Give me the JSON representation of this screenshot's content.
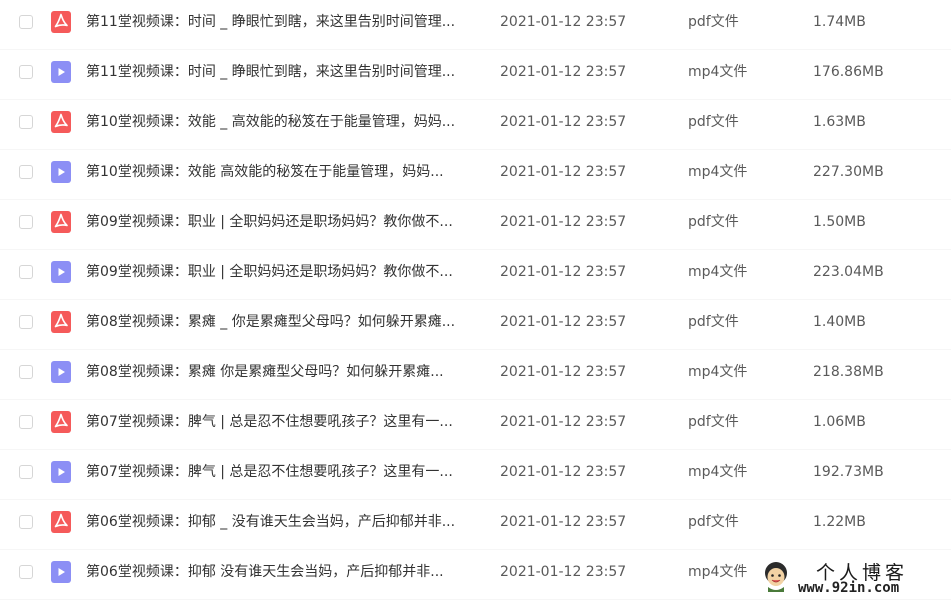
{
  "colors": {
    "pdf_icon": "#f55a5a",
    "mp4_icon": "#8c8ff5",
    "text_primary": "#333333",
    "text_secondary": "#5a5a5a"
  },
  "files": [
    {
      "name": "第11堂视频课：时间 _ 睁眼忙到瞎，来这里告别时间管理...",
      "date": "2021-01-12 23:57",
      "type": "pdf文件",
      "size": "1.74MB",
      "icon": "pdf-icon"
    },
    {
      "name": "第11堂视频课：时间 _ 睁眼忙到瞎，来这里告别时间管理...",
      "date": "2021-01-12 23:57",
      "type": "mp4文件",
      "size": "176.86MB",
      "icon": "video-icon"
    },
    {
      "name": "第10堂视频课：效能 _ 高效能的秘笈在于能量管理，妈妈...",
      "date": "2021-01-12 23:57",
      "type": "pdf文件",
      "size": "1.63MB",
      "icon": "pdf-icon"
    },
    {
      "name": "第10堂视频课：效能  高效能的秘笈在于能量管理，妈妈...",
      "date": "2021-01-12 23:57",
      "type": "mp4文件",
      "size": "227.30MB",
      "icon": "video-icon"
    },
    {
      "name": "第09堂视频课：职业 | 全职妈妈还是职场妈妈？教你做不...",
      "date": "2021-01-12 23:57",
      "type": "pdf文件",
      "size": "1.50MB",
      "icon": "pdf-icon"
    },
    {
      "name": "第09堂视频课：职业 | 全职妈妈还是职场妈妈？教你做不...",
      "date": "2021-01-12 23:57",
      "type": "mp4文件",
      "size": "223.04MB",
      "icon": "video-icon"
    },
    {
      "name": "第08堂视频课：累瘫 _ 你是累瘫型父母吗？如何躲开累瘫...",
      "date": "2021-01-12 23:57",
      "type": "pdf文件",
      "size": "1.40MB",
      "icon": "pdf-icon"
    },
    {
      "name": "第08堂视频课：累瘫  你是累瘫型父母吗？如何躲开累瘫...",
      "date": "2021-01-12 23:57",
      "type": "mp4文件",
      "size": "218.38MB",
      "icon": "video-icon"
    },
    {
      "name": "第07堂视频课：脾气 | 总是忍不住想要吼孩子？这里有一...",
      "date": "2021-01-12 23:57",
      "type": "pdf文件",
      "size": "1.06MB",
      "icon": "pdf-icon"
    },
    {
      "name": "第07堂视频课：脾气 | 总是忍不住想要吼孩子？这里有一...",
      "date": "2021-01-12 23:57",
      "type": "mp4文件",
      "size": "192.73MB",
      "icon": "video-icon"
    },
    {
      "name": "第06堂视频课：抑郁 _ 没有谁天生会当妈，产后抑郁并非...",
      "date": "2021-01-12 23:57",
      "type": "pdf文件",
      "size": "1.22MB",
      "icon": "pdf-icon"
    },
    {
      "name": "第06堂视频课：抑郁  没有谁天生会当妈，产后抑郁并非...",
      "date": "2021-01-12 23:57",
      "type": "mp4文件",
      "size": "",
      "icon": "video-icon"
    }
  ],
  "watermark": {
    "title": "个人博客",
    "url": "www.92in.com"
  }
}
